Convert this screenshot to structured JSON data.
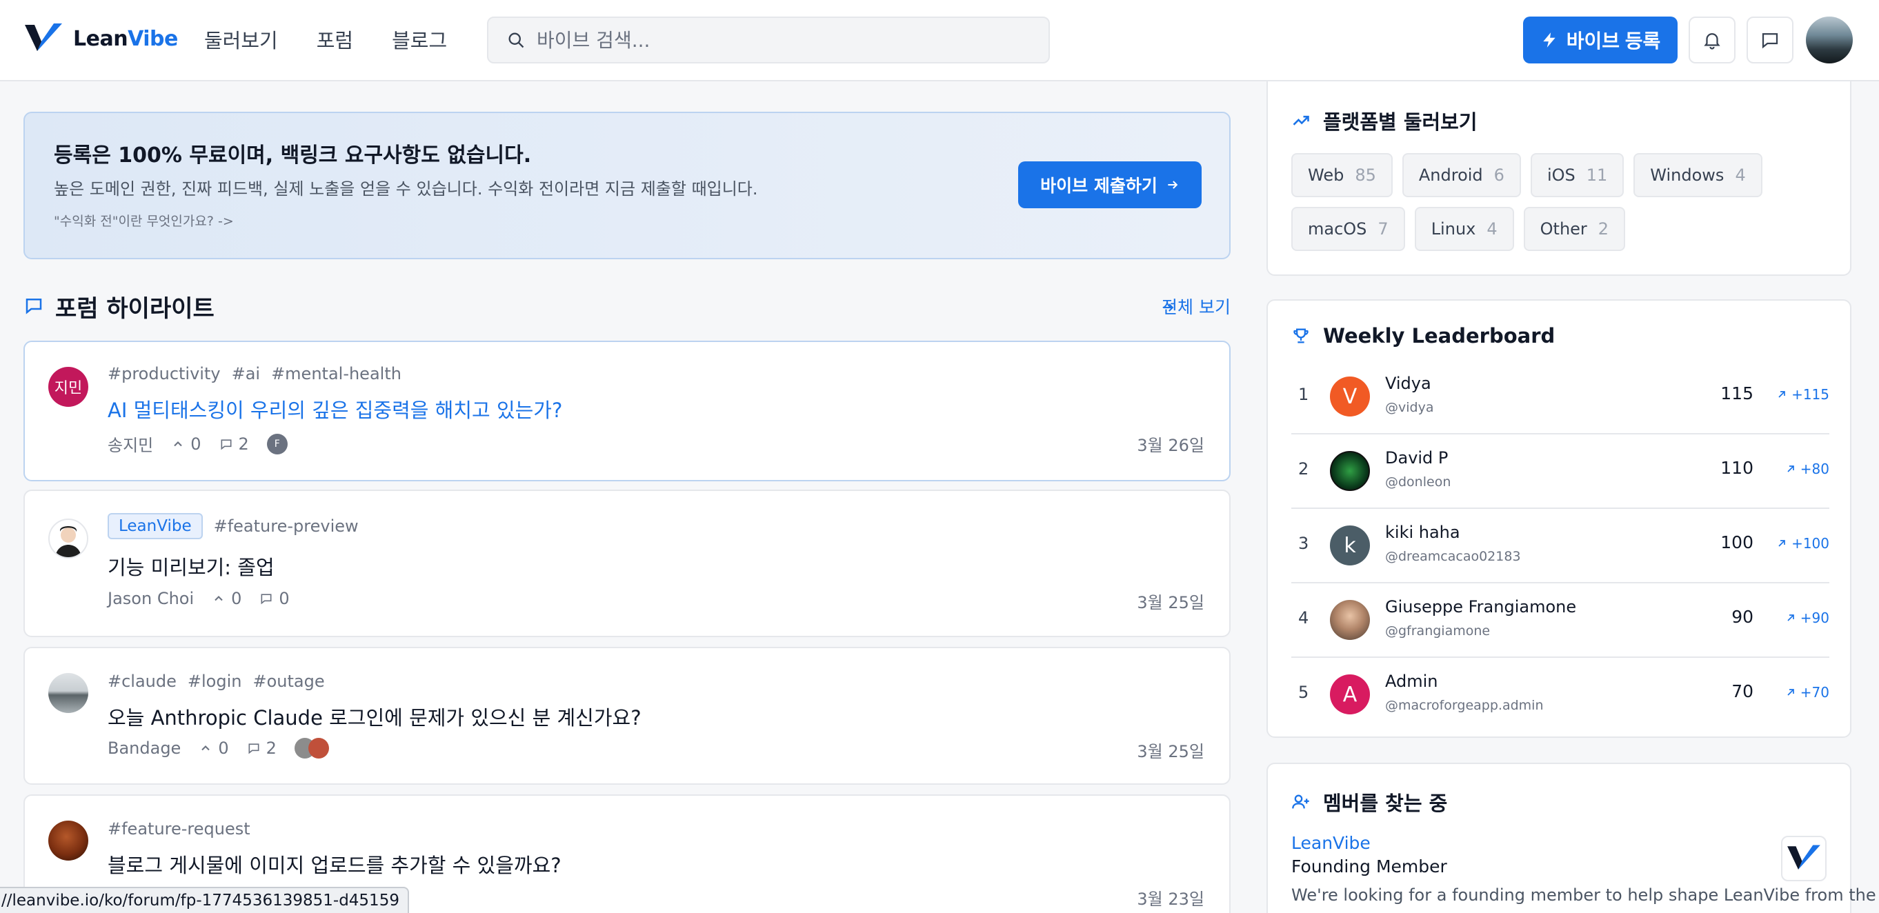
{
  "header": {
    "logo_text_a": "Lean",
    "logo_text_b": "Vibe",
    "nav": [
      "둘러보기",
      "포럼",
      "블로그"
    ],
    "search_placeholder": "바이브 검색...",
    "register_label": "바이브 등록"
  },
  "banner": {
    "title": "등록은 100% 무료이며, 백링크 요구사항도 없습니다.",
    "description": "높은 도메인 권한, 진짜 피드백, 실제 노출을 얻을 수 있습니다. 수익화 전이라면 지금 제출할 때입니다.",
    "link": "\"수익화 전\"이란 무엇인가요? ->",
    "button_label": "바이브 제출하기"
  },
  "forum": {
    "title": "포럼 하이라이트",
    "view_all": "전체 보기",
    "posts": [
      {
        "avatar_text": "지민",
        "tags": [
          "#productivity",
          "#ai",
          "#mental-health"
        ],
        "badge": "",
        "title": "AI 멀티태스킹이 우리의 깊은 집중력을 해치고 있는가?",
        "author": "송지민",
        "upvotes": "0",
        "comments": "2",
        "participant_initial": "F",
        "date": "3월 26일"
      },
      {
        "avatar_text": "",
        "tags": [
          "#feature-preview"
        ],
        "badge": "LeanVibe",
        "title": "기능 미리보기: 졸업",
        "author": "Jason Choi",
        "upvotes": "0",
        "comments": "0",
        "date": "3월 25일"
      },
      {
        "avatar_text": "",
        "tags": [
          "#claude",
          "#login",
          "#outage"
        ],
        "badge": "",
        "title": "오늘 Anthropic Claude 로그인에 문제가 있으신 분 계신가요?",
        "author": "Bandage",
        "upvotes": "0",
        "comments": "2",
        "date": "3월 25일"
      },
      {
        "avatar_text": "",
        "tags": [
          "#feature-request"
        ],
        "badge": "",
        "title": "블로그 게시물에 이미지 업로드를 추가할 수 있을까요?",
        "author": "",
        "upvotes": "",
        "comments": "",
        "date": "3월 23일"
      }
    ]
  },
  "status_url": "//leanvibe.io/ko/forum/fp-1774536139851-d45159",
  "platforms": {
    "title": "플랫폼별 둘러보기",
    "items": [
      {
        "name": "Web",
        "count": "85"
      },
      {
        "name": "Android",
        "count": "6"
      },
      {
        "name": "iOS",
        "count": "11"
      },
      {
        "name": "Windows",
        "count": "4"
      },
      {
        "name": "macOS",
        "count": "7"
      },
      {
        "name": "Linux",
        "count": "4"
      },
      {
        "name": "Other",
        "count": "2"
      }
    ]
  },
  "leaderboard": {
    "title": "Weekly Leaderboard",
    "rows": [
      {
        "rank": "1",
        "initial": "V",
        "name": "Vidya",
        "handle": "@vidya",
        "score": "115",
        "delta": "+115",
        "color": "#f15a24"
      },
      {
        "rank": "2",
        "initial": "",
        "name": "David P",
        "handle": "@donleon",
        "score": "110",
        "delta": "+80",
        "color": "#0b3d1c"
      },
      {
        "rank": "3",
        "initial": "k",
        "name": "kiki haha",
        "handle": "@dreamcacao02183",
        "score": "100",
        "delta": "+100",
        "color": "#4b5d67"
      },
      {
        "rank": "4",
        "initial": "",
        "name": "Giuseppe Frangiamone",
        "handle": "@gfrangiamone",
        "score": "90",
        "delta": "+90",
        "color": "#8a6a55"
      },
      {
        "rank": "5",
        "initial": "A",
        "name": "Admin",
        "handle": "@macroforgeapp.admin",
        "score": "70",
        "delta": "+70",
        "color": "#d81b60"
      }
    ]
  },
  "members": {
    "title": "멤버를 찾는 중",
    "company": "LeanVibe",
    "role": "Founding Member",
    "description": "We're looking for a founding member to help shape LeanVibe from the"
  },
  "colors": {
    "accent": "#1a73e8",
    "post1_avatar": "#c2185b"
  }
}
